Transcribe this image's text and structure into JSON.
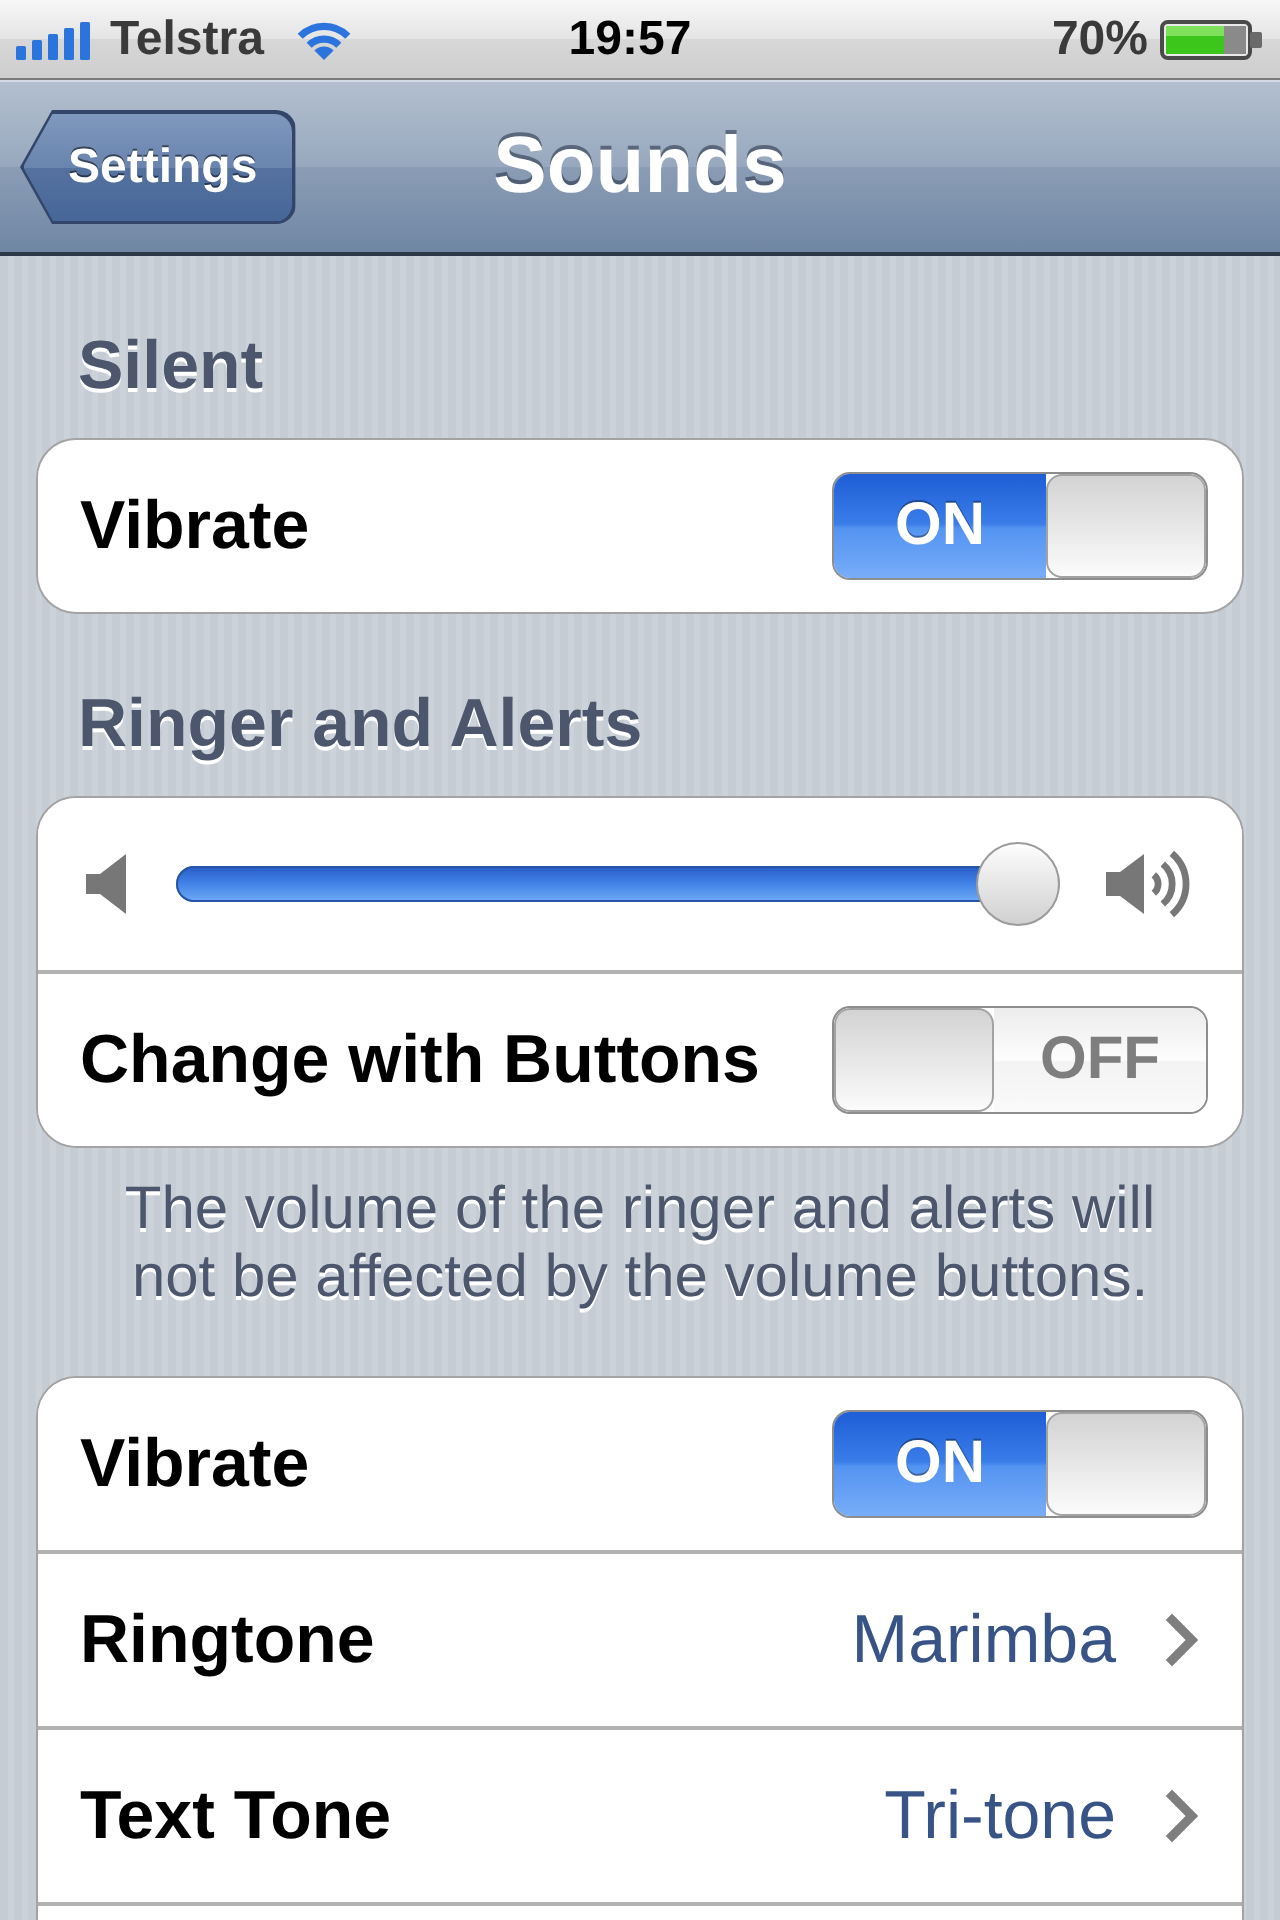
{
  "status_bar": {
    "carrier": "Telstra",
    "time": "19:57",
    "battery": "70%"
  },
  "nav_bar": {
    "back_button": "Settings",
    "title": "Sounds"
  },
  "groups": [
    {
      "header": "Silent",
      "rows": [
        {
          "kind": "switch",
          "label": "Vibrate",
          "on": true,
          "switch_text": "ON"
        }
      ]
    },
    {
      "header": "Ringer and Alerts",
      "rows": [
        {
          "kind": "slider",
          "level": 1
        },
        {
          "kind": "switch",
          "label": "Change with Buttons",
          "on": false,
          "switch_text": "OFF"
        }
      ],
      "footer": "The volume of the ringer and alerts will not be affected by the volume buttons."
    },
    {
      "rows": [
        {
          "kind": "switch",
          "label": "Vibrate",
          "on": true,
          "switch_text": "ON"
        },
        {
          "kind": "disclosure",
          "label": "Ringtone",
          "value": "Marimba"
        },
        {
          "kind": "disclosure",
          "label": "Text Tone",
          "value": "Tri-tone"
        }
      ]
    }
  ]
}
